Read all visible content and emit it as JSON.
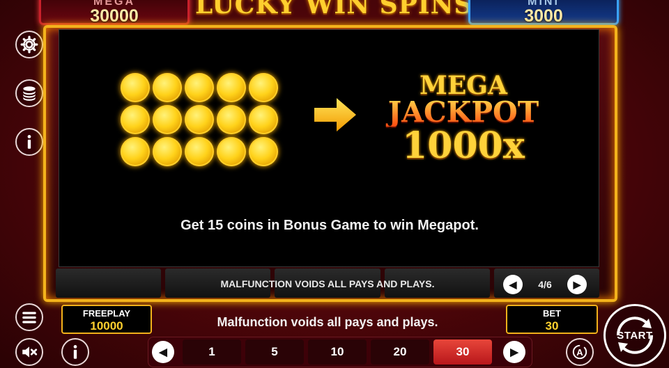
{
  "header": {
    "title": "LUCKY WIN SPINS",
    "mega_jackpot": {
      "label": "MEGA",
      "value": "30000"
    },
    "mini_jackpot": {
      "label": "MINI",
      "value": "3000"
    }
  },
  "sidebar": {
    "buttons": [
      {
        "name": "settings",
        "icon": "gear-icon"
      },
      {
        "name": "coins",
        "icon": "coin-stack-icon"
      },
      {
        "name": "info",
        "icon": "info-icon"
      }
    ]
  },
  "info_panel": {
    "coin_count": 15,
    "jackpot": {
      "line1": "MEGA",
      "line2": "JACKPOT",
      "line3": "1000x"
    },
    "rule": "Get 15 coins in Bonus Game to win Megapot.",
    "pager": {
      "text": "4/6",
      "prev_icon": "chevron-left-icon",
      "next_icon": "chevron-right-icon"
    }
  },
  "panel_footer": {
    "malfunction": "MALFUNCTION VOIDS ALL PAYS AND PLAYS."
  },
  "status": {
    "freeplay": {
      "label": "FREEPLAY",
      "value": "10000"
    },
    "bet": {
      "label": "BET",
      "value": "30"
    },
    "malfunction": "Malfunction voids all pays and plays."
  },
  "bet_selector": {
    "options": [
      "1",
      "5",
      "10",
      "20",
      "30"
    ],
    "selected": "30"
  },
  "controls": {
    "start_label": "START",
    "menu_icon": "menu-icon",
    "sound_icon": "sound-off-icon",
    "info_icon": "info-icon",
    "autoplay_icon": "autoplay-icon"
  },
  "colors": {
    "gold": "#f3b31c",
    "selected_bet": "#d4302c",
    "mega_border": "#c9202b",
    "mini_border": "#3aa3ff"
  }
}
